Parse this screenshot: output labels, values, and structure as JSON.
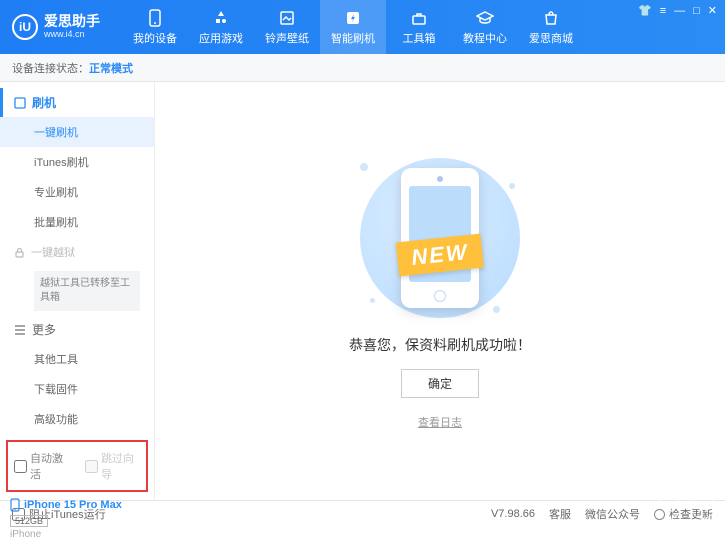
{
  "header": {
    "logo_letter": "iU",
    "title": "爱思助手",
    "url": "www.i4.cn",
    "nav": [
      {
        "label": "我的设备"
      },
      {
        "label": "应用游戏"
      },
      {
        "label": "铃声壁纸"
      },
      {
        "label": "智能刷机"
      },
      {
        "label": "工具箱"
      },
      {
        "label": "教程中心"
      },
      {
        "label": "爱思商城"
      }
    ],
    "active_nav": 3
  },
  "status": {
    "label": "设备连接状态：",
    "value": "正常模式"
  },
  "sidebar": {
    "sections": [
      {
        "title": "刷机",
        "active": true,
        "items": [
          {
            "label": "一键刷机",
            "active": true
          },
          {
            "label": "iTunes刷机"
          },
          {
            "label": "专业刷机"
          },
          {
            "label": "批量刷机"
          }
        ]
      },
      {
        "title": "一键越狱",
        "locked": true,
        "note": "越狱工具已转移至工具箱"
      },
      {
        "title": "更多",
        "items": [
          {
            "label": "其他工具"
          },
          {
            "label": "下载固件"
          },
          {
            "label": "高级功能"
          }
        ]
      }
    ],
    "checkboxes": {
      "auto_activate": "自动激活",
      "skip_wizard": "跳过向导"
    },
    "device": {
      "name": "iPhone 15 Pro Max",
      "capacity": "512GB",
      "type": "iPhone"
    }
  },
  "main": {
    "ribbon": "NEW",
    "message": "恭喜您，保资料刷机成功啦！",
    "ok": "确定",
    "log_link": "查看日志"
  },
  "footer": {
    "block_itunes": "阻止iTunes运行",
    "version": "V7.98.66",
    "links": [
      "客服",
      "微信公众号",
      "检查更新"
    ]
  }
}
